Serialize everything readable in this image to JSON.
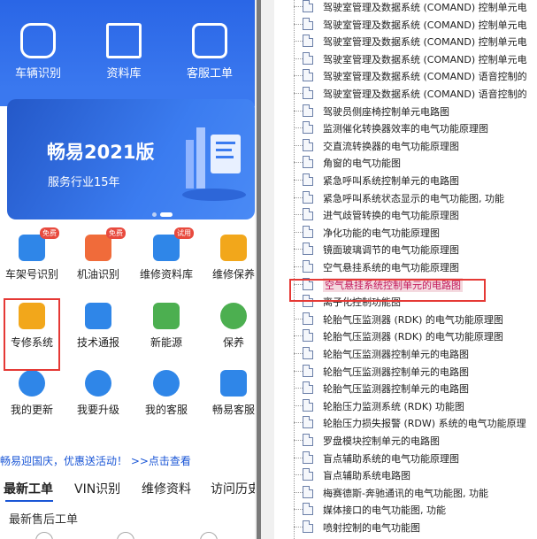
{
  "left": {
    "header": {
      "items": [
        "车辆识别",
        "资料库",
        "客服工单"
      ]
    },
    "banner": {
      "title": "畅易2021版",
      "subtitle": "服务行业15年"
    },
    "grid": [
      {
        "label": "车架号识别",
        "badge": "免费",
        "icon": "car-icon",
        "color": "#2f86e8"
      },
      {
        "label": "机油识别",
        "badge": "免费",
        "icon": "oil-icon",
        "color": "#f06b3a"
      },
      {
        "label": "维修资料库",
        "badge": "试用",
        "icon": "repair-library-icon",
        "color": "#2f86e8"
      },
      {
        "label": "维修保养",
        "badge": "",
        "icon": "maintenance-icon",
        "color": "#f2a71b"
      },
      {
        "label": "专修系统",
        "badge": "",
        "icon": "clipboard-icon",
        "color": "#f2a71b"
      },
      {
        "label": "技术通报",
        "badge": "",
        "icon": "tech-bulletin-icon",
        "color": "#2f86e8"
      },
      {
        "label": "新能源",
        "badge": "",
        "icon": "leaf-icon",
        "color": "#4caf50"
      },
      {
        "label": "保养",
        "badge": "",
        "icon": "power-icon",
        "color": "#4caf50"
      },
      {
        "label": "我的更新",
        "badge": "",
        "icon": "refresh-icon",
        "color": "#2f86e8"
      },
      {
        "label": "我要升级",
        "badge": "",
        "icon": "upgrade-icon",
        "color": "#2f86e8"
      },
      {
        "label": "我的客服",
        "badge": "",
        "icon": "chat-icon",
        "color": "#2f86e8"
      },
      {
        "label": "畅易客服",
        "badge": "",
        "icon": "service-icon",
        "color": "#2f86e8"
      }
    ],
    "notice": "畅易迎国庆，优惠送活动！ >>点击查看",
    "tabs": [
      "最新工单",
      "VIN识别",
      "维修资料",
      "访问历史"
    ],
    "subtitle": "最新售后工单"
  },
  "right": {
    "rows": [
      "驾驶室管理及数据系统 (COMAND) 控制单元电",
      "驾驶室管理及数据系统 (COMAND) 控制单元电",
      "驾驶室管理及数据系统 (COMAND) 控制单元电",
      "驾驶室管理及数据系统 (COMAND) 控制单元电",
      "驾驶室管理及数据系统 (COMAND) 语音控制的",
      "驾驶室管理及数据系统 (COMAND) 语音控制的",
      "驾驶员侧座椅控制单元电路图",
      "监测催化转换器效率的电气功能原理图",
      "交直流转换器的电气功能原理图",
      "角窗的电气功能图",
      "紧急呼叫系统控制单元的电路图",
      "紧急呼叫系统状态显示的电气功能图, 功能",
      "进气歧管转换的电气功能原理图",
      "净化功能的电气功能原理图",
      "镜面玻璃调节的电气功能原理图",
      "空气悬挂系统的电气功能原理图",
      "空气悬挂系统控制单元的电路图",
      "离子化控制功能图",
      "轮胎气压监测器 (RDK) 的电气功能原理图",
      "轮胎气压监测器 (RDK) 的电气功能原理图",
      "轮胎气压监测器控制单元的电路图",
      "轮胎气压监测器控制单元的电路图",
      "轮胎气压监测器控制单元的电路图",
      "轮胎压力监测系统 (RDK) 功能图",
      "轮胎压力损失报警 (RDW) 系统的电气功能原理",
      "罗盘模块控制单元的电路图",
      "盲点辅助系统的电气功能原理图",
      "盲点辅助系统电路图",
      "梅赛德斯-奔驰通讯的电气功能图, 功能",
      "媒体接口的电气功能图, 功能",
      "喷射控制的电气功能图"
    ],
    "selected_index": 16
  }
}
